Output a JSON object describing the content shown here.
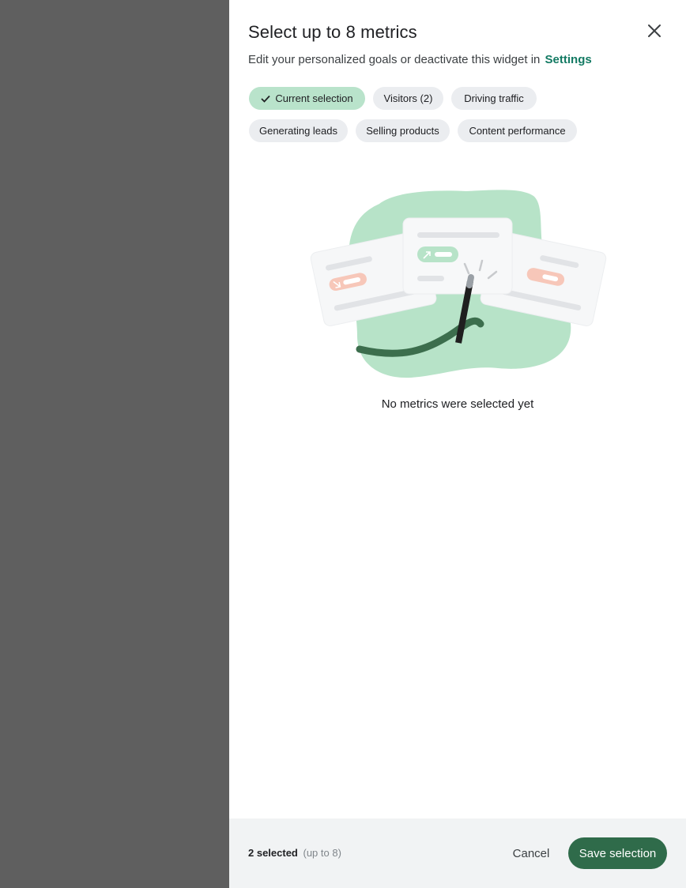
{
  "dialog": {
    "title": "Select up to 8 metrics",
    "subtitle_text": "Edit your personalized goals or deactivate this widget in",
    "settings_link": "Settings"
  },
  "chips": [
    {
      "label": "Current selection",
      "selected": true
    },
    {
      "label": "Visitors (2)",
      "selected": false
    },
    {
      "label": "Driving traffic",
      "selected": false
    },
    {
      "label": "Generating leads",
      "selected": false
    },
    {
      "label": "Selling products",
      "selected": false
    },
    {
      "label": "Content performance",
      "selected": false
    }
  ],
  "empty_state": {
    "message": "No metrics were selected yet",
    "icon": "magic-wand-illustration"
  },
  "footer": {
    "selected_count": "2 selected",
    "limit_note": "(up to 8)",
    "cancel_label": "Cancel",
    "save_label": "Save selection"
  },
  "colors": {
    "accent_link": "#137a63",
    "selected_chip": "#b9e3cb",
    "save_button": "#2f6b4a",
    "overlay": "#5f5f5f"
  }
}
